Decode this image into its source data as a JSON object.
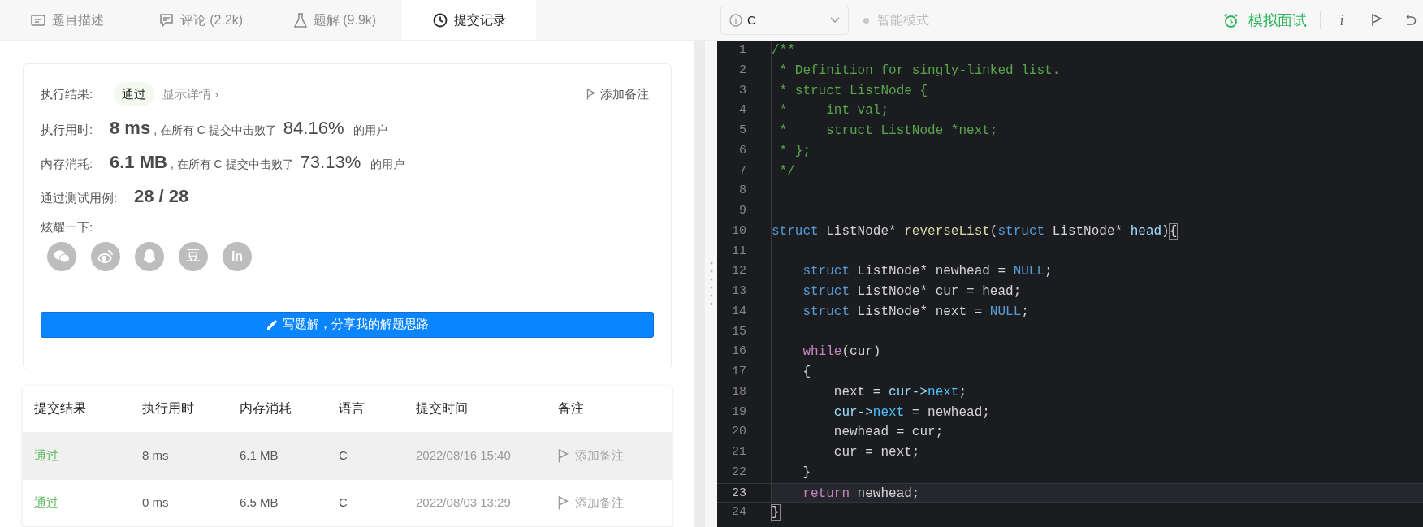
{
  "tabs": [
    {
      "label": "题目描述",
      "selected": false
    },
    {
      "label": "评论 (2.2k)",
      "selected": false
    },
    {
      "label": "题解 (9.9k)",
      "selected": false
    },
    {
      "label": "提交记录",
      "selected": true
    }
  ],
  "toolbar": {
    "language": "C",
    "smart_mode": {
      "label": "智能模式",
      "on": false
    },
    "mock_interview": "模拟面试",
    "info_glyph": "i"
  },
  "result": {
    "label": "执行结果:",
    "status": "通过",
    "details_link": "显示详情 ›",
    "add_note": "添加备注",
    "stats": [
      {
        "label": "执行用时:",
        "value": "8 ms",
        "middle": ", 在所有 C 提交中击败了",
        "percent": "84.16%",
        "suffix": "的用户"
      },
      {
        "label": "内存消耗:",
        "value": "6.1 MB",
        "middle": ", 在所有 C 提交中击败了",
        "percent": "73.13%",
        "suffix": "的用户"
      }
    ],
    "tests": {
      "label": "通过测试用例:",
      "value": "28 / 28"
    },
    "share": {
      "label": "炫耀一下:",
      "items": [
        {
          "kind": "wechat"
        },
        {
          "kind": "weibo"
        },
        {
          "kind": "qq"
        },
        {
          "kind": "douban",
          "text": "豆"
        },
        {
          "kind": "linkedin",
          "text": "in"
        }
      ]
    },
    "write_button": "写题解，分享我的解题思路"
  },
  "table": {
    "columns": [
      "提交结果",
      "执行用时",
      "内存消耗",
      "语言",
      "提交时间",
      "备注"
    ],
    "rows": [
      {
        "highlighted": true,
        "cells": [
          "通过",
          "8 ms",
          "6.1 MB",
          "C",
          "2022/08/16 15:40",
          "添加备注"
        ]
      },
      {
        "highlighted": false,
        "cells": [
          "通过",
          "0 ms",
          "6.5 MB",
          "C",
          "2022/08/03 13:29",
          "添加备注"
        ]
      }
    ]
  },
  "editor": {
    "lines": [
      {
        "number": "1",
        "active": false,
        "tokens": [
          {
            "kind": "comment",
            "text": "/**"
          }
        ]
      },
      {
        "number": "2",
        "active": false,
        "tokens": [
          {
            "kind": "comment",
            "text": " * Definition for singly-linked list."
          }
        ]
      },
      {
        "number": "3",
        "active": false,
        "tokens": [
          {
            "kind": "comment",
            "text": " * struct ListNode {"
          }
        ]
      },
      {
        "number": "4",
        "active": false,
        "tokens": [
          {
            "kind": "comment",
            "text": " *     int val;"
          }
        ]
      },
      {
        "number": "5",
        "active": false,
        "tokens": [
          {
            "kind": "comment",
            "text": " *     struct ListNode *next;"
          }
        ]
      },
      {
        "number": "6",
        "active": false,
        "tokens": [
          {
            "kind": "comment",
            "text": " * };"
          }
        ]
      },
      {
        "number": "7",
        "active": false,
        "tokens": [
          {
            "kind": "comment",
            "text": " */"
          }
        ]
      },
      {
        "number": "8",
        "active": false
      },
      {
        "number": "9",
        "active": false
      },
      {
        "number": "10",
        "active": false,
        "tokens": [
          {
            "kind": "keyword",
            "text": "struct"
          },
          {
            "kind": "plain",
            "text": " ListNode* "
          },
          {
            "kind": "function",
            "text": "reverseList"
          },
          {
            "kind": "plain",
            "text": "("
          },
          {
            "kind": "keyword",
            "text": "struct"
          },
          {
            "kind": "plain",
            "text": " ListNode* "
          },
          {
            "kind": "variable",
            "text": "head"
          },
          {
            "kind": "plain",
            "text": ")"
          },
          {
            "kind": "bracket_match",
            "text": "{"
          }
        ]
      },
      {
        "number": "11",
        "active": false
      },
      {
        "number": "12",
        "active": false,
        "tokens": [
          {
            "kind": "keyword",
            "text": "    struct"
          },
          {
            "kind": "plain",
            "text": " ListNode* newhead = "
          },
          {
            "kind": "keyword",
            "text": "NULL"
          },
          {
            "kind": "plain",
            "text": ";"
          }
        ]
      },
      {
        "number": "13",
        "active": false,
        "tokens": [
          {
            "kind": "keyword",
            "text": "    struct"
          },
          {
            "kind": "plain",
            "text": " ListNode* cur = head;"
          }
        ]
      },
      {
        "number": "14",
        "active": false,
        "tokens": [
          {
            "kind": "keyword",
            "text": "    struct"
          },
          {
            "kind": "plain",
            "text": " ListNode* next = "
          },
          {
            "kind": "keyword",
            "text": "NULL"
          },
          {
            "kind": "plain",
            "text": ";"
          }
        ]
      },
      {
        "number": "15",
        "active": false
      },
      {
        "number": "16",
        "active": false,
        "tokens": [
          {
            "kind": "control",
            "text": "    while"
          },
          {
            "kind": "plain",
            "text": "(cur)"
          }
        ]
      },
      {
        "number": "17",
        "active": false,
        "tokens": [
          {
            "kind": "plain",
            "text": "    {"
          }
        ]
      },
      {
        "number": "18",
        "active": false,
        "tokens": [
          {
            "kind": "plain",
            "text": "        next = "
          },
          {
            "kind": "variable",
            "text": "cur->"
          },
          {
            "kind": "member",
            "text": "next"
          },
          {
            "kind": "plain",
            "text": ";"
          }
        ]
      },
      {
        "number": "19",
        "active": false,
        "tokens": [
          {
            "kind": "variable",
            "text": "        cur->"
          },
          {
            "kind": "member",
            "text": "next"
          },
          {
            "kind": "plain",
            "text": " = newhead;"
          }
        ]
      },
      {
        "number": "20",
        "active": false,
        "tokens": [
          {
            "kind": "plain",
            "text": "        newhead = cur;"
          }
        ]
      },
      {
        "number": "21",
        "active": false,
        "tokens": [
          {
            "kind": "plain",
            "text": "        cur = next;"
          }
        ]
      },
      {
        "number": "22",
        "active": false,
        "tokens": [
          {
            "kind": "plain",
            "text": "    }"
          }
        ]
      },
      {
        "number": "23",
        "active": true,
        "tokens": [
          {
            "kind": "control",
            "text": "    return"
          },
          {
            "kind": "plain",
            "text": " newhead;"
          }
        ]
      },
      {
        "number": "24",
        "active": false,
        "tokens": [
          {
            "kind": "bracket_match",
            "text": "}"
          }
        ]
      }
    ]
  }
}
